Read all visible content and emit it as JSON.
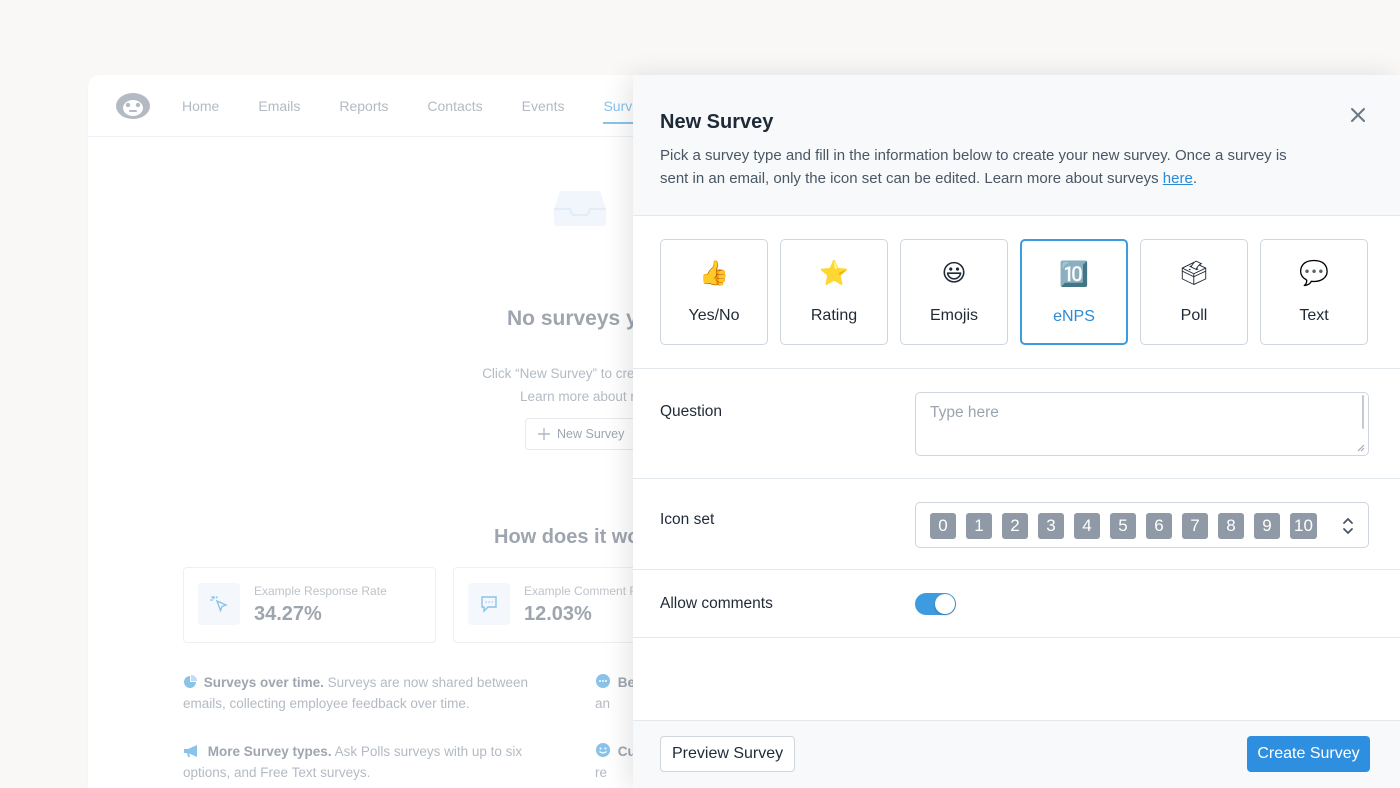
{
  "background": {
    "nav": [
      "Home",
      "Emails",
      "Reports",
      "Contacts",
      "Events",
      "Surveys"
    ],
    "empty_title": "No surveys yet",
    "empty_desc_line1": "Click “New Survey” to create reusable surveys and c",
    "empty_desc_line2": "Learn more about reusable surveys in o",
    "new_survey_button": "New Survey",
    "how_title": "How does it wo",
    "stats": [
      {
        "label": "Example Response Rate",
        "value": "34.27%",
        "icon": "cursor-click-icon"
      },
      {
        "label": "Example Comment R",
        "value": "12.03%",
        "icon": "comment-icon"
      }
    ],
    "features": [
      {
        "title": "Surveys over time.",
        "text": "Surveys are now shared between emails, collecting employee feedback over time.",
        "icon": "pie-chart-icon"
      },
      {
        "title": "More Survey types.",
        "text": "Ask Polls surveys with up to six options, and Free Text surveys.",
        "icon": "megaphone-icon"
      },
      {
        "title": "Be",
        "text": "an",
        "icon": "chat-bubble-icon"
      },
      {
        "title": "Cu",
        "text": "re",
        "icon": "smiley-icon"
      }
    ]
  },
  "modal": {
    "title": "New Survey",
    "description": "Pick a survey type and fill in the information below to create your new survey. Once a survey is sent in an email, only the icon set can be edited. Learn more about surveys ",
    "link_text": "here",
    "trailing": ".",
    "survey_types": [
      {
        "label": "Yes/No",
        "icon": "thumbs-up-icon",
        "glyph": "👍"
      },
      {
        "label": "Rating",
        "icon": "star-icon",
        "glyph": "⭐"
      },
      {
        "label": "Emojis",
        "icon": "smiley-icon",
        "glyph": "😃"
      },
      {
        "label": "eNPS",
        "icon": "keycap-ten-icon",
        "glyph": "🔟"
      },
      {
        "label": "Poll",
        "icon": "ballot-box-icon",
        "glyph": "🗳"
      },
      {
        "label": "Text",
        "icon": "speech-bubble-icon",
        "glyph": "💬"
      }
    ],
    "selected_type": "eNPS",
    "question_label": "Question",
    "question_placeholder": "Type here",
    "question_value": "",
    "icon_set_label": "Icon set",
    "icon_set": [
      "0",
      "1",
      "2",
      "3",
      "4",
      "5",
      "6",
      "7",
      "8",
      "9",
      "10"
    ],
    "allow_comments_label": "Allow comments",
    "allow_comments": true,
    "preview_button": "Preview Survey",
    "create_button": "Create Survey"
  },
  "colors": {
    "accent": "#2e8fe0",
    "selected_border": "#3d9be0",
    "chip": "#8f9aa6"
  }
}
